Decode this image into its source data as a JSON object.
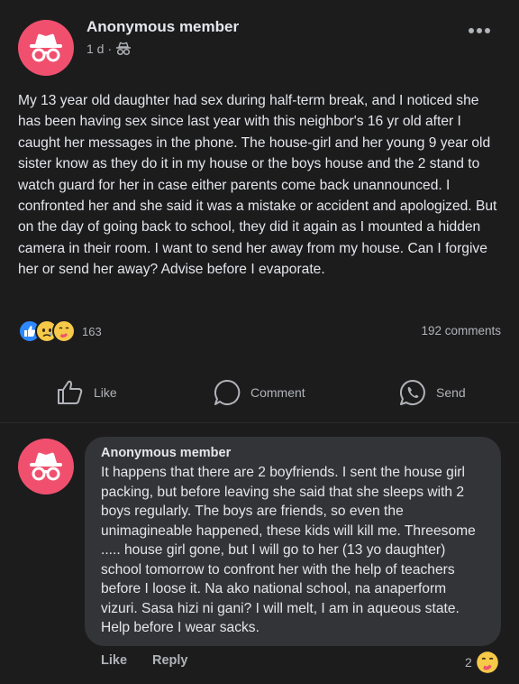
{
  "post": {
    "author": "Anonymous member",
    "time": "1 d",
    "separator": "·",
    "body": "My 13 year old daughter had sex during half-term break, and I noticed she has been having sex since last year with this neighbor's 16 yr old after I caught her messages in the phone. The house-girl and her young 9 year old sister know as they do it in my house or the boys house and the 2 stand to watch guard for her in case either parents come back unannounced. I confronted her and she said it was a mistake or accident and apologized. But on the day of going back to school, they did it again as I mounted a hidden camera in their room. I want to send her away from my house. Can I forgive her or send her away? Advise before I evaporate.",
    "reaction_count": "163",
    "comments_count": "192 comments",
    "reactions": [
      "like",
      "sad",
      "care"
    ]
  },
  "actions": {
    "like": "Like",
    "comment": "Comment",
    "send": "Send"
  },
  "comment": {
    "author": "Anonymous member",
    "text": "It happens that there are 2 boyfriends. I sent the house girl packing, but before leaving she said that she sleeps with 2 boys regularly. The boys are friends, so even the unimagineable happened, these kids will kill me. Threesome ..... house girl gone, but I will go to her (13 yo daughter) school tomorrow to confront her with the help of teachers before I loose it. Na ako national school, na anaperform vizuri. Sasa hizi ni gani? I will melt, I am in aqueous state. Help before I wear sacks.",
    "like_label": "Like",
    "reply_label": "Reply",
    "reaction_count": "2"
  },
  "colors": {
    "background": "#1c1c1d",
    "avatar": "#f0506e",
    "bubble": "#333437",
    "like_blue": "#2d88ff"
  }
}
